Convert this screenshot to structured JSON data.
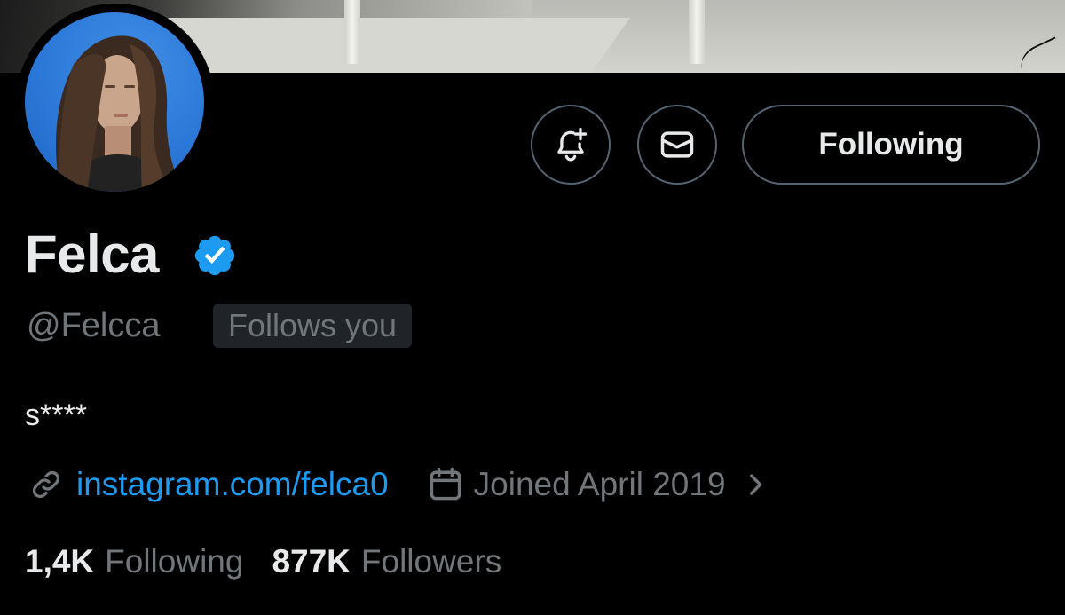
{
  "profile": {
    "display_name": "Felca",
    "handle": "@Felcca",
    "follows_you_label": "Follows you",
    "bio": "s****",
    "link_text": "instagram.com/felca0",
    "joined_text": "Joined April 2019",
    "following_count": "1,4K",
    "following_label": "Following",
    "followers_count": "877K",
    "followers_label": "Followers",
    "verified": true
  },
  "actions": {
    "following_button_label": "Following",
    "notify_icon": "bell-plus-icon",
    "message_icon": "envelope-icon"
  },
  "icons": {
    "verified": "verified-badge-icon",
    "link": "link-icon",
    "calendar": "calendar-icon",
    "chevron": "chevron-right-icon"
  },
  "colors": {
    "background": "#000000",
    "primary_text": "#e7e9ea",
    "secondary_text": "#71767b",
    "accent_blue": "#1d9bf0",
    "border": "#536471",
    "chip_bg": "#202327"
  }
}
